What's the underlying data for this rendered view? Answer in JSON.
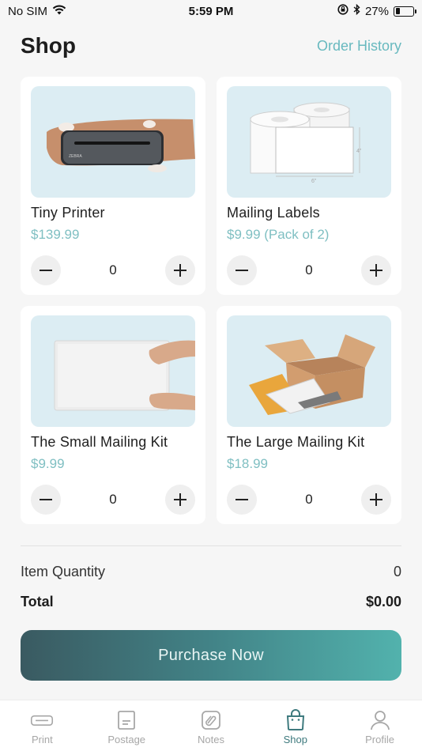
{
  "status_bar": {
    "carrier": "No SIM",
    "time": "5:59 PM",
    "battery_text": "27%",
    "battery_level": 0.27
  },
  "header": {
    "title": "Shop",
    "order_history": "Order History"
  },
  "products": [
    {
      "name": "Tiny Printer",
      "price": "$139.99",
      "quantity": "0",
      "image": "printer-in-hands",
      "printer_brand": "ZEBRA"
    },
    {
      "name": "Mailing Labels",
      "price": "$9.99 (Pack of 2)",
      "quantity": "0",
      "image": "label-rolls",
      "dim_height": "4\"",
      "dim_width": "6\""
    },
    {
      "name": "The Small Mailing Kit",
      "price": "$9.99",
      "quantity": "0",
      "image": "bubble-mailer"
    },
    {
      "name": "The Large Mailing Kit",
      "price": "$18.99",
      "quantity": "0",
      "image": "box-and-mailers"
    }
  ],
  "summary": {
    "item_quantity_label": "Item Quantity",
    "item_quantity_value": "0",
    "total_label": "Total",
    "total_value": "$0.00"
  },
  "purchase_button": "Purchase Now",
  "tabs": [
    {
      "label": "Print",
      "icon": "printer-icon",
      "active": false
    },
    {
      "label": "Postage",
      "icon": "postage-icon",
      "active": false
    },
    {
      "label": "Notes",
      "icon": "notes-icon",
      "active": false
    },
    {
      "label": "Shop",
      "icon": "shopping-bag-icon",
      "active": true
    },
    {
      "label": "Profile",
      "icon": "profile-icon",
      "active": false
    }
  ],
  "colors": {
    "accent": "#68b9bf",
    "price": "#7fbfc2",
    "card_image_bg": "#dcedf3",
    "button_gradient_start": "#3a5a61",
    "button_gradient_end": "#52b2ad",
    "active_tab": "#3e7a7e",
    "inactive_tab": "#a7a7a7"
  }
}
